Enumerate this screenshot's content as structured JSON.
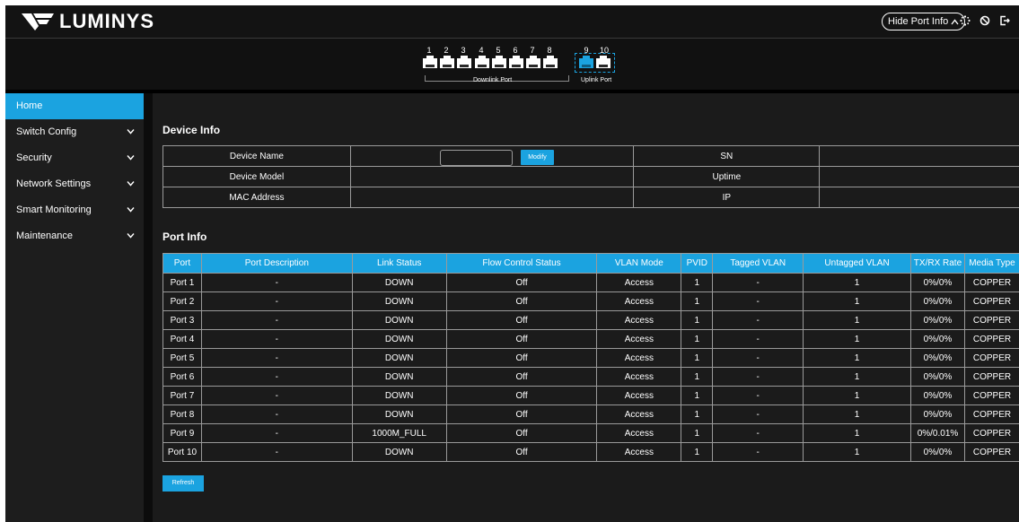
{
  "brand": {
    "name": "LUMINYS"
  },
  "header": {
    "hide_port_info": "Hide Port Info",
    "icons": [
      "loading-icon",
      "settings-icon",
      "logout-icon"
    ]
  },
  "ports": {
    "numbers": [
      "1",
      "2",
      "3",
      "4",
      "5",
      "6",
      "7",
      "8",
      "9",
      "10"
    ],
    "downlink_label": "Downlink Port",
    "uplink_label": "Uplink Port",
    "active_port": "9"
  },
  "sidebar": {
    "items": [
      {
        "label": "Home",
        "active": true,
        "chevron": false
      },
      {
        "label": "Switch Config",
        "active": false,
        "chevron": true
      },
      {
        "label": "Security",
        "active": false,
        "chevron": true
      },
      {
        "label": "Network Settings",
        "active": false,
        "chevron": true
      },
      {
        "label": "Smart Monitoring",
        "active": false,
        "chevron": true
      },
      {
        "label": "Maintenance",
        "active": false,
        "chevron": true
      }
    ]
  },
  "device_info": {
    "title": "Device Info",
    "device_name_label": "Device Name",
    "device_name_value": "",
    "modify_label": "Modify",
    "device_model_label": "Device Model",
    "device_model_value": "",
    "mac_label": "MAC Address",
    "mac_value": "",
    "sn_label": "SN",
    "sn_value": "",
    "uptime_label": "Uptime",
    "uptime_value": "",
    "ip_label": "IP",
    "ip_value": ""
  },
  "port_info": {
    "title": "Port Info",
    "columns": [
      "Port",
      "Port Description",
      "Link Status",
      "Flow Control Status",
      "VLAN Mode",
      "PVID",
      "Tagged VLAN",
      "Untagged VLAN",
      "TX/RX Rate",
      "Media Type"
    ],
    "rows": [
      [
        "Port 1",
        "-",
        "DOWN",
        "Off",
        "Access",
        "1",
        "-",
        "1",
        "0%/0%",
        "COPPER"
      ],
      [
        "Port 2",
        "-",
        "DOWN",
        "Off",
        "Access",
        "1",
        "-",
        "1",
        "0%/0%",
        "COPPER"
      ],
      [
        "Port 3",
        "-",
        "DOWN",
        "Off",
        "Access",
        "1",
        "-",
        "1",
        "0%/0%",
        "COPPER"
      ],
      [
        "Port 4",
        "-",
        "DOWN",
        "Off",
        "Access",
        "1",
        "-",
        "1",
        "0%/0%",
        "COPPER"
      ],
      [
        "Port 5",
        "-",
        "DOWN",
        "Off",
        "Access",
        "1",
        "-",
        "1",
        "0%/0%",
        "COPPER"
      ],
      [
        "Port 6",
        "-",
        "DOWN",
        "Off",
        "Access",
        "1",
        "-",
        "1",
        "0%/0%",
        "COPPER"
      ],
      [
        "Port 7",
        "-",
        "DOWN",
        "Off",
        "Access",
        "1",
        "-",
        "1",
        "0%/0%",
        "COPPER"
      ],
      [
        "Port 8",
        "-",
        "DOWN",
        "Off",
        "Access",
        "1",
        "-",
        "1",
        "0%/0%",
        "COPPER"
      ],
      [
        "Port 9",
        "-",
        "1000M_FULL",
        "Off",
        "Access",
        "1",
        "-",
        "1",
        "0%/0.01%",
        "COPPER"
      ],
      [
        "Port 10",
        "-",
        "DOWN",
        "Off",
        "Access",
        "1",
        "-",
        "1",
        "0%/0%",
        "COPPER"
      ]
    ],
    "refresh_label": "Refresh"
  },
  "colors": {
    "accent": "#1ba3e0",
    "background": "#1b1b1b",
    "header": "#131313"
  }
}
